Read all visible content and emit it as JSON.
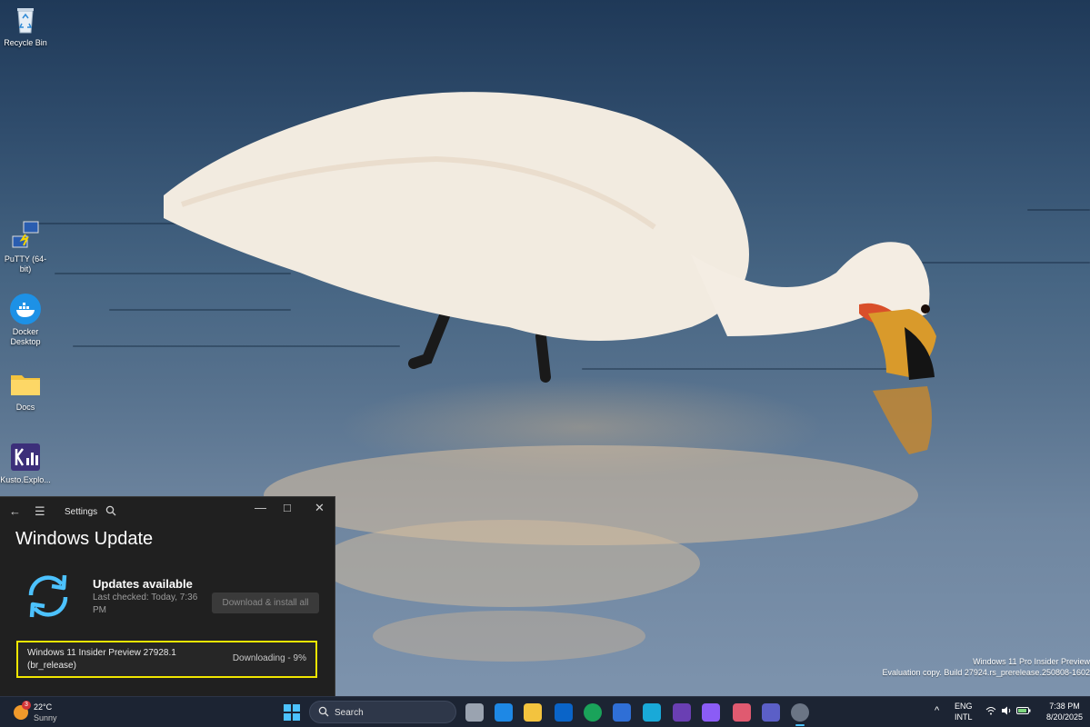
{
  "desktop": {
    "icons": [
      {
        "label": "Recycle Bin",
        "icon": "recycle-bin-icon"
      },
      {
        "label": "PuTTY (64-bit)",
        "icon": "putty-icon"
      },
      {
        "label": "Docker Desktop",
        "icon": "docker-icon"
      },
      {
        "label": "Docs",
        "icon": "folder-icon"
      },
      {
        "label": "Kusto.Explo...",
        "icon": "kusto-explorer-icon"
      }
    ]
  },
  "settings_window": {
    "app_title": "Settings",
    "page_title": "Windows Update",
    "status_title": "Updates available",
    "last_checked": "Last checked: Today, 7:36 PM",
    "install_button": "Download & install all",
    "update_item": {
      "name": "Windows 11 Insider Preview 27928.1 (br_release)",
      "status": "Downloading - 9%"
    },
    "controls": {
      "minimize": "—",
      "maximize": "□",
      "close": "✕"
    }
  },
  "watermark": {
    "line1": "Windows 11 Pro Insider Preview",
    "line2": "Evaluation copy. Build 27924.rs_prerelease.250808-1602"
  },
  "taskbar": {
    "weather": {
      "temp": "22°C",
      "condition": "Sunny",
      "badge": "3"
    },
    "search_label": "Search",
    "apps": [
      "task-view-icon",
      "outlook-new-icon",
      "file-explorer-icon",
      "outlook-icon",
      "edge-icon",
      "remote-desktop-icon",
      "store-icon",
      "terminal-icon",
      "visual-studio-icon",
      "snipping-tool-icon",
      "teams-icon",
      "settings-icon"
    ],
    "tray": {
      "language": "ENG",
      "layout": "INTL",
      "time": "7:38 PM",
      "date": "8/20/2025"
    }
  },
  "colors": {
    "accent": "#4cc2ff",
    "highlight_border": "#f1e600",
    "window_bg": "#202020",
    "taskbar_bg": "#1c2433"
  }
}
